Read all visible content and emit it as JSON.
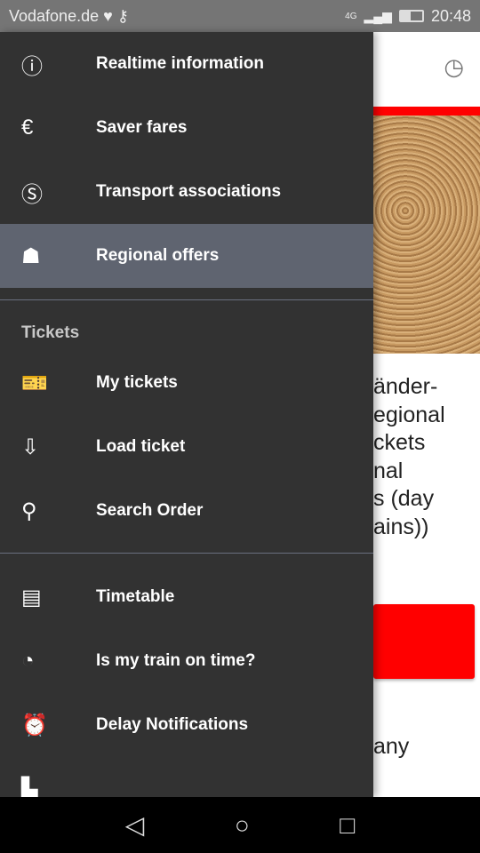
{
  "status": {
    "carrier": "Vodafone.de",
    "network": "4G",
    "time": "20:48"
  },
  "background": {
    "text_lines": [
      "änder-",
      "egional",
      "ckets",
      "nal",
      "s (day",
      "ains))"
    ],
    "bottom_text": "any"
  },
  "drawer": {
    "items_top": [
      {
        "label": "Realtime information",
        "icon": "realtime-info-icon",
        "glyph": "ⓘ"
      },
      {
        "label": "Saver fares",
        "icon": "saver-fares-icon",
        "glyph": "€"
      },
      {
        "label": "Transport associations",
        "icon": "transport-associations-icon",
        "glyph": "Ⓢ"
      },
      {
        "label": "Regional offers",
        "icon": "regional-offers-icon",
        "glyph": "☗",
        "selected": true
      }
    ],
    "tickets_header": "Tickets",
    "tickets": [
      {
        "label": "My tickets",
        "icon": "my-tickets-icon",
        "glyph": "🎫"
      },
      {
        "label": "Load ticket",
        "icon": "load-ticket-icon",
        "glyph": "⇩"
      },
      {
        "label": "Search Order",
        "icon": "search-icon",
        "glyph": "⚲"
      }
    ],
    "items_bottom": [
      {
        "label": "Timetable",
        "icon": "timetable-icon",
        "glyph": "▤"
      },
      {
        "label": "Is my train on time?",
        "icon": "train-on-time-icon",
        "glyph": "◔"
      },
      {
        "label": "Delay Notifications",
        "icon": "alarm-clock-icon",
        "glyph": "⏰"
      },
      {
        "label": "",
        "icon": "map-icon",
        "glyph": "▙"
      }
    ]
  },
  "colors": {
    "drawer_bg": "#323232",
    "selected_bg": "#5f6470",
    "accent": "#ff0000"
  }
}
